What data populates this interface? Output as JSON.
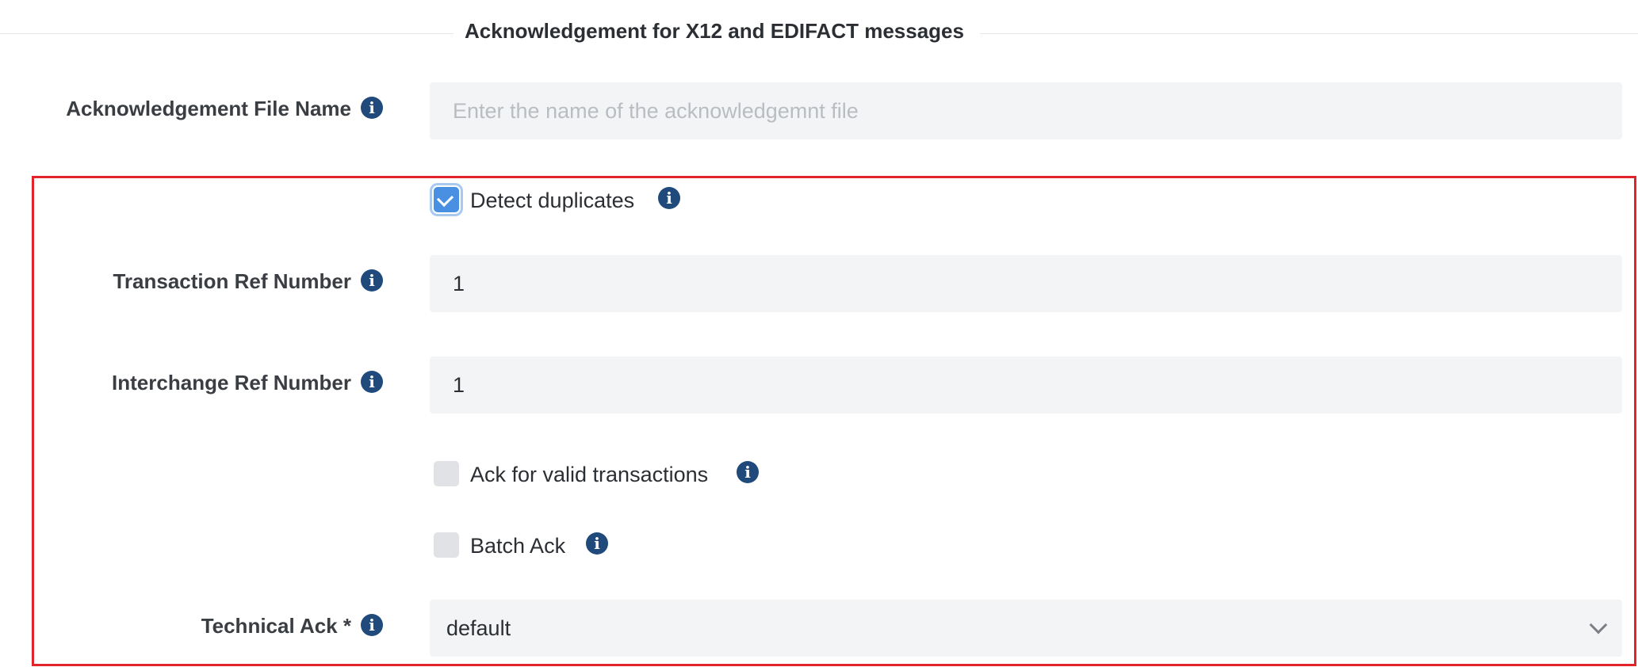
{
  "section": {
    "title": "Acknowledgement for X12 and EDIFACT messages"
  },
  "ack_file_name": {
    "label": "Acknowledgement File Name",
    "value": "",
    "placeholder": "Enter the name of the acknowledgemnt file"
  },
  "detect_duplicates": {
    "label": "Detect duplicates",
    "checked": true
  },
  "transaction_ref": {
    "label": "Transaction Ref Number",
    "value": "1"
  },
  "interchange_ref": {
    "label": "Interchange Ref Number",
    "value": "1"
  },
  "ack_valid": {
    "label": "Ack for valid transactions",
    "checked": false
  },
  "batch_ack": {
    "label": "Batch Ack",
    "checked": false
  },
  "technical_ack": {
    "label": "Technical Ack *",
    "value": "default"
  },
  "colors": {
    "info_icon": "#1f4a7b",
    "checkbox_checked": "#4a90e2",
    "field_bg": "#f3f4f6",
    "highlight_border": "#e3232a"
  },
  "icons": {
    "info": "info-icon",
    "check": "checkmark-icon",
    "dropdown": "chevron-down-icon"
  }
}
